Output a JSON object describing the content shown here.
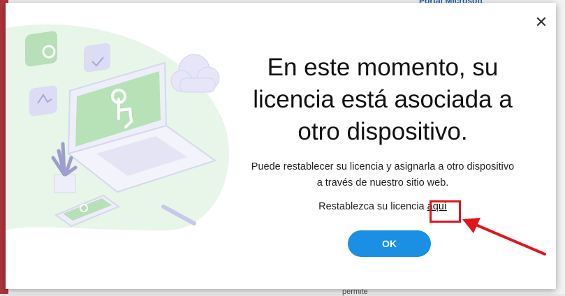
{
  "background": {
    "top_text": "Portal Microsoft",
    "bottom_text": "permite"
  },
  "dialog": {
    "close_icon": "close-icon",
    "heading": "En este momento, su licencia está asociada a otro dispositivo.",
    "description_line1": "Puede restablecer su licencia y asignarla a otro dispositivo",
    "description_line2": "a través de nuestro sitio web.",
    "reset_prefix": "Restablezca su licencia ",
    "reset_link": "aquí",
    "ok_label": "OK"
  },
  "colors": {
    "accent": "#1a8fe3",
    "highlight": "#e0141b",
    "illustration_green": "#c9e8c9"
  }
}
